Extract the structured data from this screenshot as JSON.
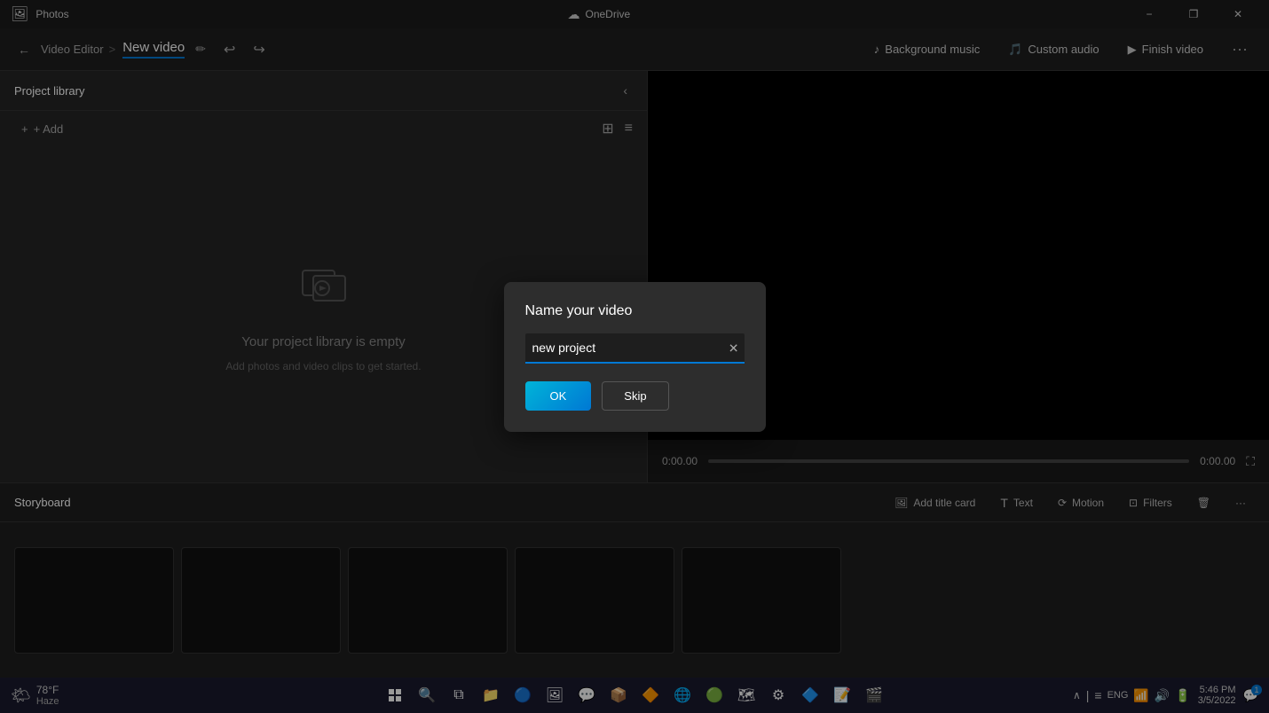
{
  "app": {
    "title": "Photos",
    "onedrive_label": "OneDrive"
  },
  "titlebar": {
    "minimize_label": "−",
    "restore_label": "❐",
    "close_label": "✕"
  },
  "menubar": {
    "back_label": "←",
    "breadcrumb_parent": "Video Editor",
    "breadcrumb_sep": ">",
    "current_title": "New video",
    "undo_label": "↩",
    "redo_label": "↪",
    "background_music_label": "Background music",
    "custom_audio_label": "Custom audio",
    "finish_video_label": "Finish video",
    "more_label": "···"
  },
  "project_library": {
    "title": "Project library",
    "add_label": "+ Add",
    "empty_title": "Your project library is empty",
    "empty_subtitle": "Add photos and video clips to get started."
  },
  "video_controls": {
    "time_start": "0:00.00",
    "time_end": "0:00.00"
  },
  "storyboard": {
    "title": "Storyboard",
    "add_title_card_label": "Add title card",
    "text_label": "Text",
    "motion_label": "Motion",
    "filters_label": "Filters",
    "delete_label": "🗑",
    "more_label": "···"
  },
  "dialog": {
    "title": "Name your video",
    "input_value": "new project",
    "input_placeholder": "new project",
    "ok_label": "OK",
    "skip_label": "Skip"
  },
  "taskbar": {
    "weather_temp": "78°F",
    "weather_condition": "Haze",
    "search_placeholder": "Search",
    "language": "ENG",
    "time": "5:46 PM",
    "date": "3/5/2022",
    "notification_count": "1"
  }
}
